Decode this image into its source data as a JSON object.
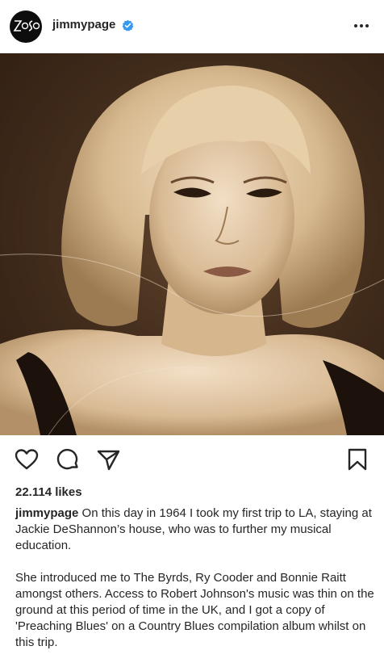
{
  "header": {
    "avatar_logo_text": "ZoSo",
    "username": "jimmypage",
    "verified_icon": "verified-badge-icon",
    "more_icon": "more-options-icon"
  },
  "post": {
    "photo_icon": "portrait-photo",
    "actions": {
      "like_icon": "heart-icon",
      "comment_icon": "comment-icon",
      "share_icon": "send-icon",
      "save_icon": "bookmark-icon"
    },
    "likes": "22.114 likes",
    "caption": {
      "username": "jimmypage",
      "paragraph1": "On this day in 1964 I took my first trip to LA, staying at Jackie DeShannon’s house, who was to further my musical education.",
      "paragraph2": "She introduced me to The Byrds, Ry Cooder and Bonnie Raitt amongst others. Access to Robert Johnson's music was thin on the ground at this period of time in the UK, and I got a copy of 'Preaching Blues' on a Country Blues compilation album whilst on this trip."
    }
  },
  "colors": {
    "text": "#262626",
    "verified": "#3897f0",
    "avatar_bg": "#0d0d0d",
    "photo_sepia": "#7a5a3d"
  }
}
